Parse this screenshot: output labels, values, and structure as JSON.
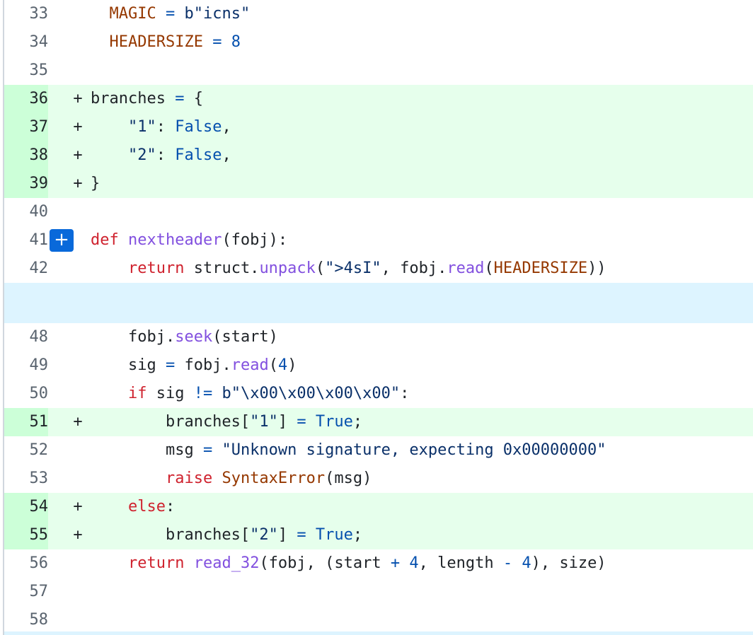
{
  "diff": {
    "expand_label": "+",
    "rows": [
      {
        "num": "33",
        "type": "ctx",
        "marker": "",
        "tokens": [
          [
            "plain",
            "  "
          ],
          [
            "const",
            "MAGIC"
          ],
          [
            "op",
            " = "
          ],
          [
            "str",
            "b\"icns\""
          ]
        ]
      },
      {
        "num": "34",
        "type": "ctx",
        "marker": "",
        "tokens": [
          [
            "plain",
            "  "
          ],
          [
            "const",
            "HEADERSIZE"
          ],
          [
            "op",
            " = "
          ],
          [
            "num",
            "8"
          ]
        ]
      },
      {
        "num": "35",
        "type": "ctx",
        "marker": "",
        "tokens": []
      },
      {
        "num": "36",
        "type": "add",
        "marker": "+",
        "tokens": [
          [
            "plain",
            "branches "
          ],
          [
            "op",
            "="
          ],
          [
            "plain",
            " {"
          ]
        ]
      },
      {
        "num": "37",
        "type": "add",
        "marker": "+",
        "tokens": [
          [
            "plain",
            "    "
          ],
          [
            "str",
            "\"1\""
          ],
          [
            "plain",
            ": "
          ],
          [
            "num",
            "False"
          ],
          [
            "plain",
            ","
          ]
        ]
      },
      {
        "num": "38",
        "type": "add",
        "marker": "+",
        "tokens": [
          [
            "plain",
            "    "
          ],
          [
            "str",
            "\"2\""
          ],
          [
            "plain",
            ": "
          ],
          [
            "num",
            "False"
          ],
          [
            "plain",
            ","
          ]
        ]
      },
      {
        "num": "39",
        "type": "add",
        "marker": "+",
        "tokens": [
          [
            "plain",
            "}"
          ]
        ]
      },
      {
        "num": "40",
        "type": "ctx",
        "marker": "",
        "tokens": []
      },
      {
        "num": "41",
        "type": "ctx",
        "marker": "",
        "expand": true,
        "tokens": [
          [
            "kw",
            "def "
          ],
          [
            "fn",
            "nextheader"
          ],
          [
            "plain",
            "(fobj):"
          ]
        ]
      },
      {
        "num": "42",
        "type": "ctx",
        "marker": "",
        "tokens": [
          [
            "plain",
            "    "
          ],
          [
            "kw",
            "return"
          ],
          [
            "plain",
            " struct."
          ],
          [
            "fn",
            "unpack"
          ],
          [
            "plain",
            "("
          ],
          [
            "str",
            "\">4sI\""
          ],
          [
            "plain",
            ", fobj."
          ],
          [
            "fn",
            "read"
          ],
          [
            "plain",
            "("
          ],
          [
            "const",
            "HEADERSIZE"
          ],
          [
            "plain",
            "))"
          ]
        ]
      },
      {
        "type": "hunk"
      },
      {
        "num": "48",
        "type": "ctx",
        "marker": "",
        "tokens": [
          [
            "plain",
            "    fobj."
          ],
          [
            "fn",
            "seek"
          ],
          [
            "plain",
            "(start)"
          ]
        ]
      },
      {
        "num": "49",
        "type": "ctx",
        "marker": "",
        "tokens": [
          [
            "plain",
            "    sig "
          ],
          [
            "op",
            "="
          ],
          [
            "plain",
            " fobj."
          ],
          [
            "fn",
            "read"
          ],
          [
            "plain",
            "("
          ],
          [
            "num",
            "4"
          ],
          [
            "plain",
            ")"
          ]
        ]
      },
      {
        "num": "50",
        "type": "ctx",
        "marker": "",
        "tokens": [
          [
            "plain",
            "    "
          ],
          [
            "kw",
            "if"
          ],
          [
            "plain",
            " sig "
          ],
          [
            "op",
            "!="
          ],
          [
            "plain",
            " "
          ],
          [
            "str",
            "b\"\\x00\\x00\\x00\\x00\""
          ],
          [
            "plain",
            ":"
          ]
        ]
      },
      {
        "num": "51",
        "type": "add",
        "marker": "+",
        "tokens": [
          [
            "plain",
            "        branches["
          ],
          [
            "str",
            "\"1\""
          ],
          [
            "plain",
            "] "
          ],
          [
            "op",
            "="
          ],
          [
            "plain",
            " "
          ],
          [
            "num",
            "True"
          ],
          [
            "plain",
            ";"
          ]
        ]
      },
      {
        "num": "52",
        "type": "ctx",
        "marker": "",
        "tokens": [
          [
            "plain",
            "        msg "
          ],
          [
            "op",
            "="
          ],
          [
            "plain",
            " "
          ],
          [
            "str",
            "\"Unknown signature, expecting 0x00000000\""
          ]
        ]
      },
      {
        "num": "53",
        "type": "ctx",
        "marker": "",
        "tokens": [
          [
            "plain",
            "        "
          ],
          [
            "kw",
            "raise"
          ],
          [
            "plain",
            " "
          ],
          [
            "const",
            "SyntaxError"
          ],
          [
            "plain",
            "(msg)"
          ]
        ]
      },
      {
        "num": "54",
        "type": "add",
        "marker": "+",
        "tokens": [
          [
            "plain",
            "    "
          ],
          [
            "kw",
            "else"
          ],
          [
            "plain",
            ":"
          ]
        ]
      },
      {
        "num": "55",
        "type": "add",
        "marker": "+",
        "tokens": [
          [
            "plain",
            "        branches["
          ],
          [
            "str",
            "\"2\""
          ],
          [
            "plain",
            "] "
          ],
          [
            "op",
            "="
          ],
          [
            "plain",
            " "
          ],
          [
            "num",
            "True"
          ],
          [
            "plain",
            ";"
          ]
        ]
      },
      {
        "num": "56",
        "type": "ctx",
        "marker": "",
        "tokens": [
          [
            "plain",
            "    "
          ],
          [
            "kw",
            "return"
          ],
          [
            "plain",
            " "
          ],
          [
            "fn",
            "read_32"
          ],
          [
            "plain",
            "(fobj, (start "
          ],
          [
            "op",
            "+"
          ],
          [
            "plain",
            " "
          ],
          [
            "num",
            "4"
          ],
          [
            "plain",
            ", length "
          ],
          [
            "op",
            "-"
          ],
          [
            "plain",
            " "
          ],
          [
            "num",
            "4"
          ],
          [
            "plain",
            "), size)"
          ]
        ]
      },
      {
        "num": "57",
        "type": "ctx",
        "marker": "",
        "tokens": []
      },
      {
        "num": "58",
        "type": "ctx",
        "marker": "",
        "tokens": []
      }
    ]
  }
}
